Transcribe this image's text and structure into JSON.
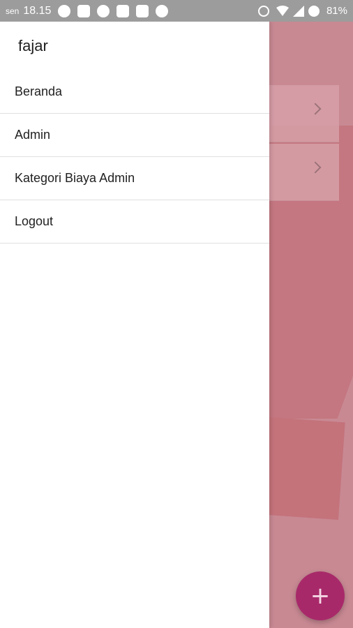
{
  "status_bar": {
    "day": "sen",
    "time": "18.15",
    "battery": "81%",
    "left_icons": [
      "whatsapp-icon",
      "youtube-icon",
      "messenger-icon",
      "instagram-icon",
      "gmail-icon",
      "pinterest-icon"
    ],
    "right_icons": [
      "alarm-icon",
      "wifi-icon",
      "signal-icon",
      "data-saver-icon"
    ]
  },
  "drawer": {
    "user_name": "fajar",
    "menu": [
      {
        "label": "Beranda"
      },
      {
        "label": "Admin"
      },
      {
        "label": "Kategori Biaya Admin"
      },
      {
        "label": "Logout"
      }
    ]
  },
  "fab": {
    "icon": "plus-icon",
    "symbol": "+"
  },
  "colors": {
    "accent": "#a8296a",
    "background": "#c88993",
    "statusbar": "#9c9c9c"
  }
}
